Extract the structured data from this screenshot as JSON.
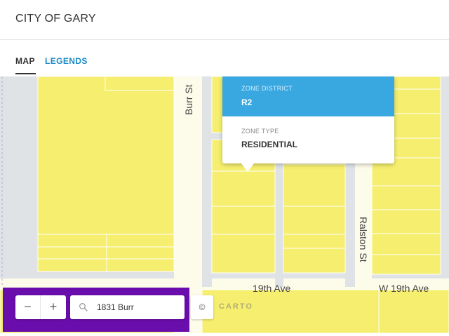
{
  "header": {
    "title": "CITY OF GARY"
  },
  "tabs": [
    {
      "label": "MAP",
      "active": true
    },
    {
      "label": "LEGENDS",
      "active": false
    }
  ],
  "map": {
    "streets": {
      "burr": "Burr St",
      "ralston": "Ralston St",
      "nineteenth": "19th Ave",
      "w_nineteenth": "W 19th Ave"
    },
    "colors": {
      "parcel": "#f5ee6e",
      "road": "#fdfbea",
      "background": "#dfe3e6",
      "accent": "#3aa8e0",
      "panel": "#6a0dad"
    }
  },
  "popup": {
    "zone_district_label": "ZONE DISTRICT",
    "zone_district_value": "R2",
    "zone_type_label": "ZONE TYPE",
    "zone_type_value": "RESIDENTIAL"
  },
  "controls": {
    "zoom_out": "−",
    "zoom_in": "+",
    "search_value": "1831 Burr",
    "search_icon": "search-icon"
  },
  "attribution": {
    "symbol": "©",
    "logo": "CARTO"
  }
}
